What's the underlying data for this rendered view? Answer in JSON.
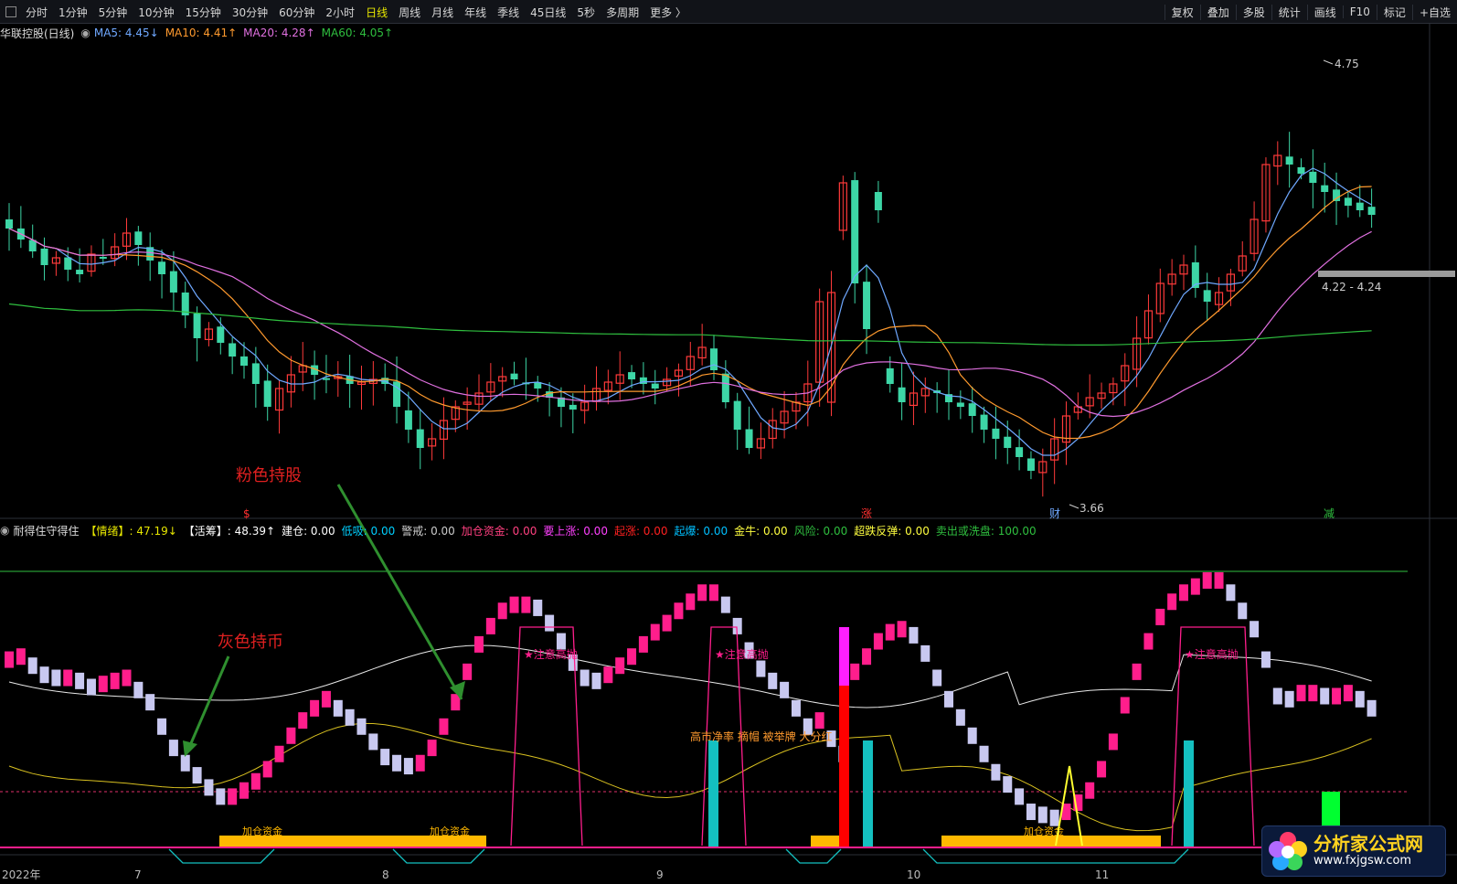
{
  "toolbar": {
    "periods": [
      "分时",
      "1分钟",
      "5分钟",
      "10分钟",
      "15分钟",
      "30分钟",
      "60分钟",
      "2小时",
      "日线",
      "周线",
      "月线",
      "年线",
      "季线",
      "45日线",
      "5秒",
      "多周期",
      "更多 〉"
    ],
    "active_period": "日线",
    "right_buttons": [
      "复权",
      "叠加",
      "多股",
      "统计",
      "画线",
      "F10",
      "标记",
      "+自选"
    ]
  },
  "main_panel": {
    "title": "华联控股(日线)",
    "ma_legend": [
      {
        "label": "MA5: 4.45↓",
        "color": "#6fa8ff"
      },
      {
        "label": "MA10: 4.41↑",
        "color": "#ff9a2e"
      },
      {
        "label": "MA20: 4.28↑",
        "color": "#e070e0"
      },
      {
        "label": "MA60: 4.05↑",
        "color": "#2fbf3f"
      }
    ],
    "price_marks": {
      "high": "4.75",
      "low": "3.66",
      "range": "4.22 - 4.24"
    },
    "event_labels": [
      {
        "text": "$",
        "color": "#ff3030"
      },
      {
        "text": "涨",
        "color": "#ff3030"
      },
      {
        "text": "财",
        "color": "#6fa8ff"
      },
      {
        "text": "减",
        "color": "#2fbf3f"
      }
    ]
  },
  "indicator_panel": {
    "title": "耐得住守得住",
    "legend": [
      {
        "label": "【情绪】: 47.19↓",
        "color": "#e6e600"
      },
      {
        "label": "【活筹】: 48.39↑",
        "color": "#ffffff"
      },
      {
        "label": "建仓: 0.00",
        "color": "#ffffff"
      },
      {
        "label": "低吸: 0.00",
        "color": "#00d0ff"
      },
      {
        "label": "警戒: 0.00",
        "color": "#cccccc"
      },
      {
        "label": "加仓资金: 0.00",
        "color": "#ff4080"
      },
      {
        "label": "要上涨: 0.00",
        "color": "#ff40ff"
      },
      {
        "label": "起涨: 0.00",
        "color": "#ff2020"
      },
      {
        "label": "起爆: 0.00",
        "color": "#00c0ff"
      },
      {
        "label": "金牛: 0.00",
        "color": "#ffff40"
      },
      {
        "label": "风险: 0.00",
        "color": "#2fbf3f"
      },
      {
        "label": "超跌反弹: 0.00",
        "color": "#ffff40"
      },
      {
        "label": "卖出或洗盘: 100.00",
        "color": "#2fbf3f"
      }
    ],
    "peak_label": "★注意高抛",
    "news_text": "高市净率 摘帽 被举牌 大分红",
    "base_label": "加仓资金"
  },
  "annotations": {
    "pink": "粉色持股",
    "gray": "灰色持币"
  },
  "xaxis": {
    "labels": [
      "2022年",
      "7",
      "8",
      "9",
      "10",
      "11"
    ]
  },
  "watermark": {
    "title": "分析家公式网",
    "url": "www.fxjgsw.com"
  },
  "colors": {
    "up": "#ff3a3a",
    "down": "#3dd6a6",
    "pink": "#ff1e8c",
    "lavender": "#c8c8f0",
    "cyan": "#14c0c0",
    "orange": "#ffb800"
  },
  "chart_data": {
    "type": "candlestick",
    "y_axis_values": {
      "high": 4.75,
      "low": 3.66,
      "range_low": 4.22,
      "range_high": 4.24
    },
    "indicator": {
      "type": "step-bar",
      "series": [
        {
          "values": [
            62,
            63,
            60,
            57,
            56,
            56,
            55,
            53,
            54,
            55,
            56,
            52,
            48,
            40,
            33,
            28,
            24,
            20,
            17,
            17,
            19,
            22,
            26,
            31,
            37,
            42,
            46,
            49,
            46,
            43,
            40,
            35,
            30,
            28,
            27,
            28,
            33,
            40,
            48,
            58,
            67,
            73,
            78,
            80,
            80,
            79,
            74,
            68,
            61,
            56,
            55,
            57,
            60,
            63,
            67,
            71,
            74,
            78,
            81,
            84,
            84,
            80,
            73,
            65,
            59,
            55,
            52,
            46,
            40,
            42,
            36,
            31,
            58,
            63,
            68,
            71,
            72,
            70,
            64,
            56,
            49,
            43,
            37,
            31,
            25,
            21,
            17,
            12,
            11,
            10,
            12,
            15,
            19,
            26,
            35,
            47,
            58,
            68,
            76,
            81,
            84,
            86,
            88,
            88,
            84,
            78,
            72,
            62,
            50,
            49,
            51,
            51,
            50,
            50,
            51,
            49,
            46
          ]
        }
      ]
    }
  }
}
